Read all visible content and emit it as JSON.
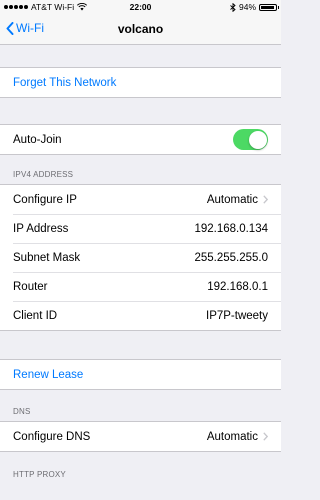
{
  "statusbar": {
    "carrier": "AT&T Wi-Fi",
    "time": "22:00",
    "battery": "94%",
    "battery_level": 0.94
  },
  "nav": {
    "back_label": "Wi-Fi",
    "title": "volcano"
  },
  "actions": {
    "forget": "Forget This Network",
    "renew": "Renew Lease"
  },
  "autojoin": {
    "label": "Auto-Join",
    "on": true
  },
  "ipv4": {
    "header": "IPV4 ADDRESS",
    "rows": [
      {
        "label": "Configure IP",
        "value": "Automatic",
        "chevron": true
      },
      {
        "label": "IP Address",
        "value": "192.168.0.134"
      },
      {
        "label": "Subnet Mask",
        "value": "255.255.255.0"
      },
      {
        "label": "Router",
        "value": "192.168.0.1"
      },
      {
        "label": "Client ID",
        "value": "IP7P-tweety"
      }
    ]
  },
  "dns": {
    "header": "DNS",
    "configure_label": "Configure DNS",
    "configure_value": "Automatic"
  },
  "proxy": {
    "header": "HTTP PROXY"
  },
  "colors": {
    "accent": "#007aff",
    "toggle_on": "#4cd964",
    "background": "#efeff4"
  }
}
